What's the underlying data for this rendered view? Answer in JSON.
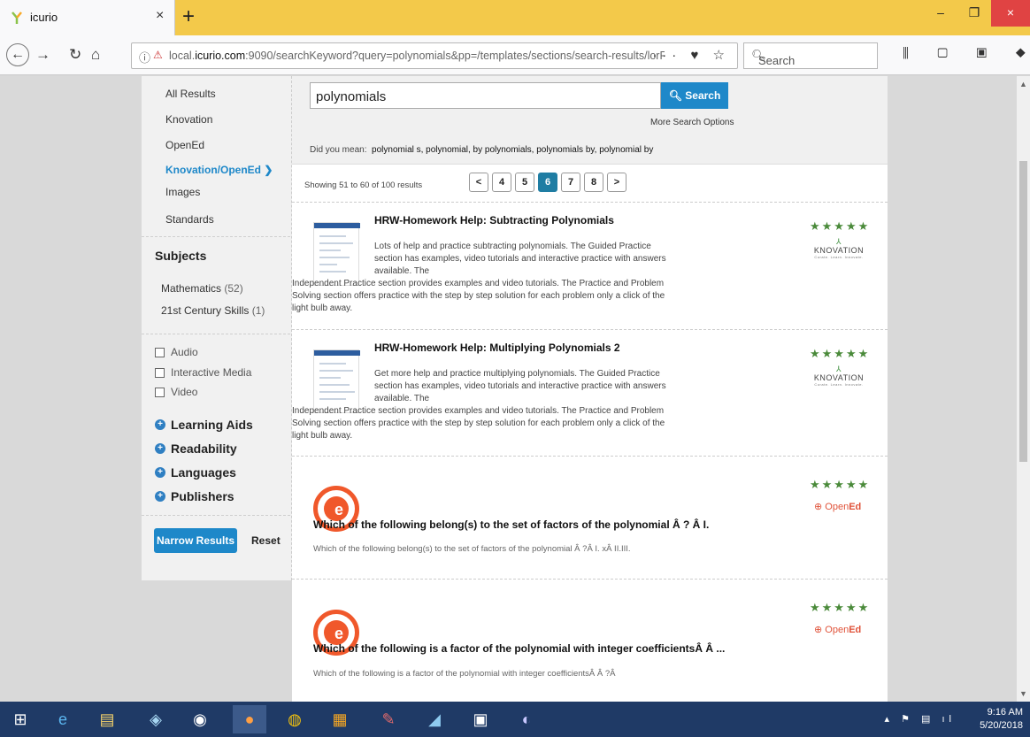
{
  "browser": {
    "tab_title": "icurio",
    "tab_close": "×",
    "new_tab": "+",
    "url_host_prefix": "local.",
    "url_host_main": "icurio.com",
    "url_rest": ":9090/searchKeyword?query=polynomials&pp=/templates/sections/search-results/lorRes",
    "page_actions": "··· ♥ ☆",
    "search_placeholder": "Search",
    "win_minimize": "–",
    "win_restore": "❐",
    "win_close": "×"
  },
  "sidebar": {
    "links": [
      "All Results",
      "Knovation",
      "OpenEd",
      "Knovation/OpenEd ❯",
      "Images",
      "Standards"
    ],
    "subjects_heading": "Subjects",
    "subjects": [
      {
        "name": "Mathematics",
        "count": "(52)"
      },
      {
        "name": "21st Century Skills",
        "count": "(1)"
      }
    ],
    "media_types": [
      "Audio",
      "Interactive Media",
      "Video"
    ],
    "facets": [
      "Learning Aids",
      "Readability",
      "Languages",
      "Publishers"
    ],
    "narrow_label": "Narrow Results",
    "reset_label": "Reset"
  },
  "search": {
    "query": "polynomials",
    "button_label": "Search",
    "more_options": "More Search Options",
    "did_you_mean_label": "Did you mean:",
    "suggestions": "polynomial s, polynomial, by polynomials, polynomials by, polynomial by"
  },
  "pagination": {
    "showing": "Showing 51 to 60 of 100 results",
    "prev": "<",
    "pages": [
      "4",
      "5",
      "6",
      "7",
      "8"
    ],
    "current": "6",
    "next": ">"
  },
  "results": [
    {
      "title": "HRW-Homework Help: Subtracting Polynomials",
      "desc_a": "Lots of help and practice subtracting polynomials. The Guided Practice section has examples, video tutorials and interactive practice with answers available. The",
      "desc_b": "Independent Practice section provides examples and video tutorials. The Practice and Problem Solving section offers practice with the step by step solution for each problem only a click of the light bulb away.",
      "stars": "★★★★★",
      "publisher": "KNOVATION",
      "publisher_tag": "Curate. Learn. Innovate."
    },
    {
      "title": "HRW-Homework Help: Multiplying Polynomials 2",
      "desc_a": "Get more help and practice multiplying polynomials. The Guided Practice section has examples, video tutorials and interactive practice with answers available. The",
      "desc_b": "Independent Practice section provides examples and video tutorials. The Practice and Problem Solving section offers practice with the step by step solution for each problem only a click of the light bulb away.",
      "stars": "★★★★★",
      "publisher": "KNOVATION",
      "publisher_tag": "Curate. Learn. Innovate."
    },
    {
      "title": "Which of the following belong(s) to the set of factors of the polynomial Â ? Â I.",
      "desc": "Which of the following belong(s) to the set of factors of the polynomial Â ?Â I. xÂ II.III.",
      "stars": "★★★★★",
      "publisher_a": "⊕ Open",
      "publisher_b": "Ed"
    },
    {
      "title": "Which of the following is a factor of the polynomial with integer coefficientsÂ Â ...",
      "desc": "Which of the following is a factor of the polynomial with integer coefficientsÂ Â ?Â",
      "stars": "★★★★★",
      "publisher_a": "⊕ Open",
      "publisher_b": "Ed"
    }
  ],
  "taskbar": {
    "time": "9:16 AM",
    "date": "5/20/2018"
  },
  "colors": {
    "accent": "#1e88c9",
    "tabbar": "#f3c94a",
    "opened": "#f0582b",
    "taskbar": "#1f3a66"
  }
}
